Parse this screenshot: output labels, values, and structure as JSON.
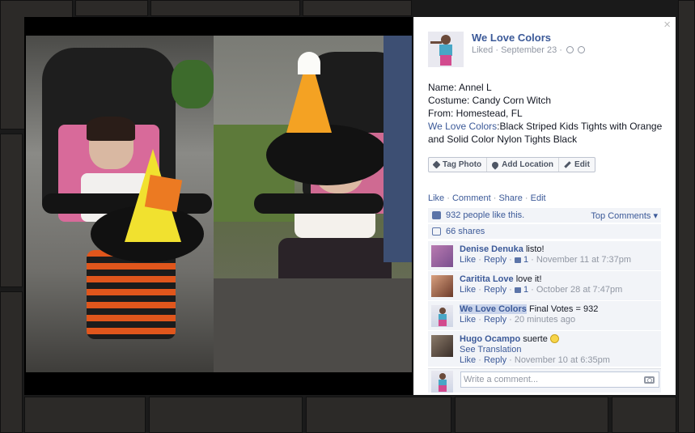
{
  "post": {
    "page_name": "We Love Colors",
    "status": "Liked",
    "date": "September 23",
    "close_glyph": "×",
    "description": {
      "name_line": "Name: Annel L",
      "costume_line": "Costume: Candy Corn Witch",
      "from_line": "From: Homestead, FL",
      "link_text": "We Love Colors",
      "product_text": ":Black Striped Kids Tights with Orange and Solid Color Nylon Tights Black"
    }
  },
  "actions": {
    "tag_photo": "Tag Photo",
    "add_location": "Add Location",
    "edit": "Edit"
  },
  "ufi": {
    "like": "Like",
    "comment": "Comment",
    "share": "Share",
    "edit": "Edit",
    "sep": "·",
    "likes_text": "932 people like this.",
    "top_comments": "Top Comments",
    "shares_text": "66 shares"
  },
  "comments": [
    {
      "author": "Denise Denuka",
      "text": "listo!",
      "like": "Like",
      "reply": "Reply",
      "likes": "1",
      "time": "November 11 at 7:37pm"
    },
    {
      "author": "Caritita Love",
      "text": "love it!",
      "like": "Like",
      "reply": "Reply",
      "likes": "1",
      "time": "October 28 at 7:47pm"
    },
    {
      "author": "We Love Colors",
      "text": "Final Votes = 932",
      "like": "Like",
      "reply": "Reply",
      "time": "20 minutes ago"
    },
    {
      "author": "Hugo Ocampo",
      "text": "suerte",
      "translation": "See Translation",
      "like": "Like",
      "reply": "Reply",
      "time": "November 10 at 6:35pm"
    }
  ],
  "composer": {
    "placeholder": "Write a comment..."
  },
  "colors": {
    "link": "#3b5998",
    "meta": "#9197a3",
    "ufi_bg": "#f2f4f8"
  }
}
